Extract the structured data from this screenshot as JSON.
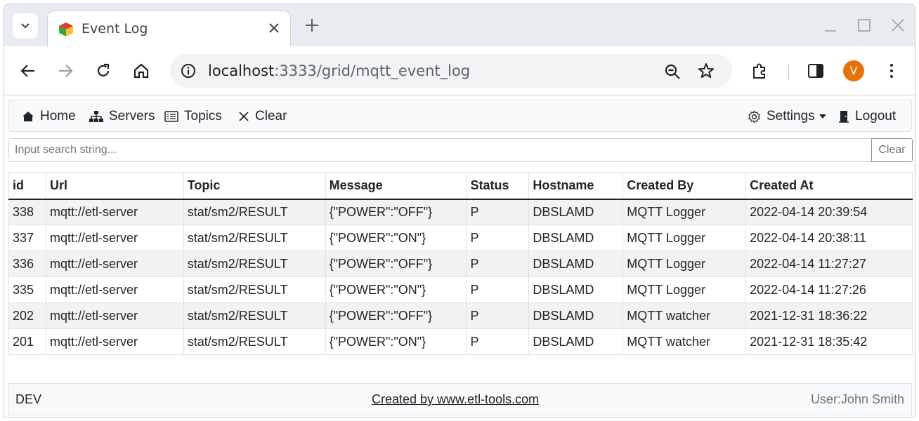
{
  "browser": {
    "tab_title": "Event Log",
    "url_host": "localhost",
    "url_rest": ":3333/grid/mqtt_event_log",
    "avatar_letter": "V",
    "avatar_color": "#e8710a"
  },
  "navbar": {
    "items": [
      {
        "label": "Home",
        "icon": "house-icon"
      },
      {
        "label": "Servers",
        "icon": "sitemap-icon"
      },
      {
        "label": "Topics",
        "icon": "list-card-icon"
      },
      {
        "label": "Clear",
        "icon": "close-icon"
      }
    ],
    "settings_label": "Settings",
    "logout_label": "Logout"
  },
  "search": {
    "placeholder": "Input search string...",
    "clear_label": "Clear"
  },
  "table": {
    "columns": [
      "id",
      "Url",
      "Topic",
      "Message",
      "Status",
      "Hostname",
      "Created By",
      "Created At"
    ],
    "rows": [
      [
        "338",
        "mqtt://etl-server",
        "stat/sm2/RESULT",
        "{\"POWER\":\"OFF\"}",
        "P",
        "DBSLAMD",
        "MQTT Logger",
        "2022-04-14 20:39:54"
      ],
      [
        "337",
        "mqtt://etl-server",
        "stat/sm2/RESULT",
        "{\"POWER\":\"ON\"}",
        "P",
        "DBSLAMD",
        "MQTT Logger",
        "2022-04-14 20:38:11"
      ],
      [
        "336",
        "mqtt://etl-server",
        "stat/sm2/RESULT",
        "{\"POWER\":\"OFF\"}",
        "P",
        "DBSLAMD",
        "MQTT Logger",
        "2022-04-14 11:27:27"
      ],
      [
        "335",
        "mqtt://etl-server",
        "stat/sm2/RESULT",
        "{\"POWER\":\"ON\"}",
        "P",
        "DBSLAMD",
        "MQTT Logger",
        "2022-04-14 11:27:26"
      ],
      [
        "202",
        "mqtt://etl-server",
        "stat/sm2/RESULT",
        "{\"POWER\":\"OFF\"}",
        "P",
        "DBSLAMD",
        "MQTT watcher",
        "2021-12-31 18:36:22"
      ],
      [
        "201",
        "mqtt://etl-server",
        "stat/sm2/RESULT",
        "{\"POWER\":\"ON\"}",
        "P",
        "DBSLAMD",
        "MQTT watcher",
        "2021-12-31 18:35:42"
      ]
    ]
  },
  "footer": {
    "env": "DEV",
    "credit": "Created by www.etl-tools.com",
    "user": "User:John Smith"
  }
}
